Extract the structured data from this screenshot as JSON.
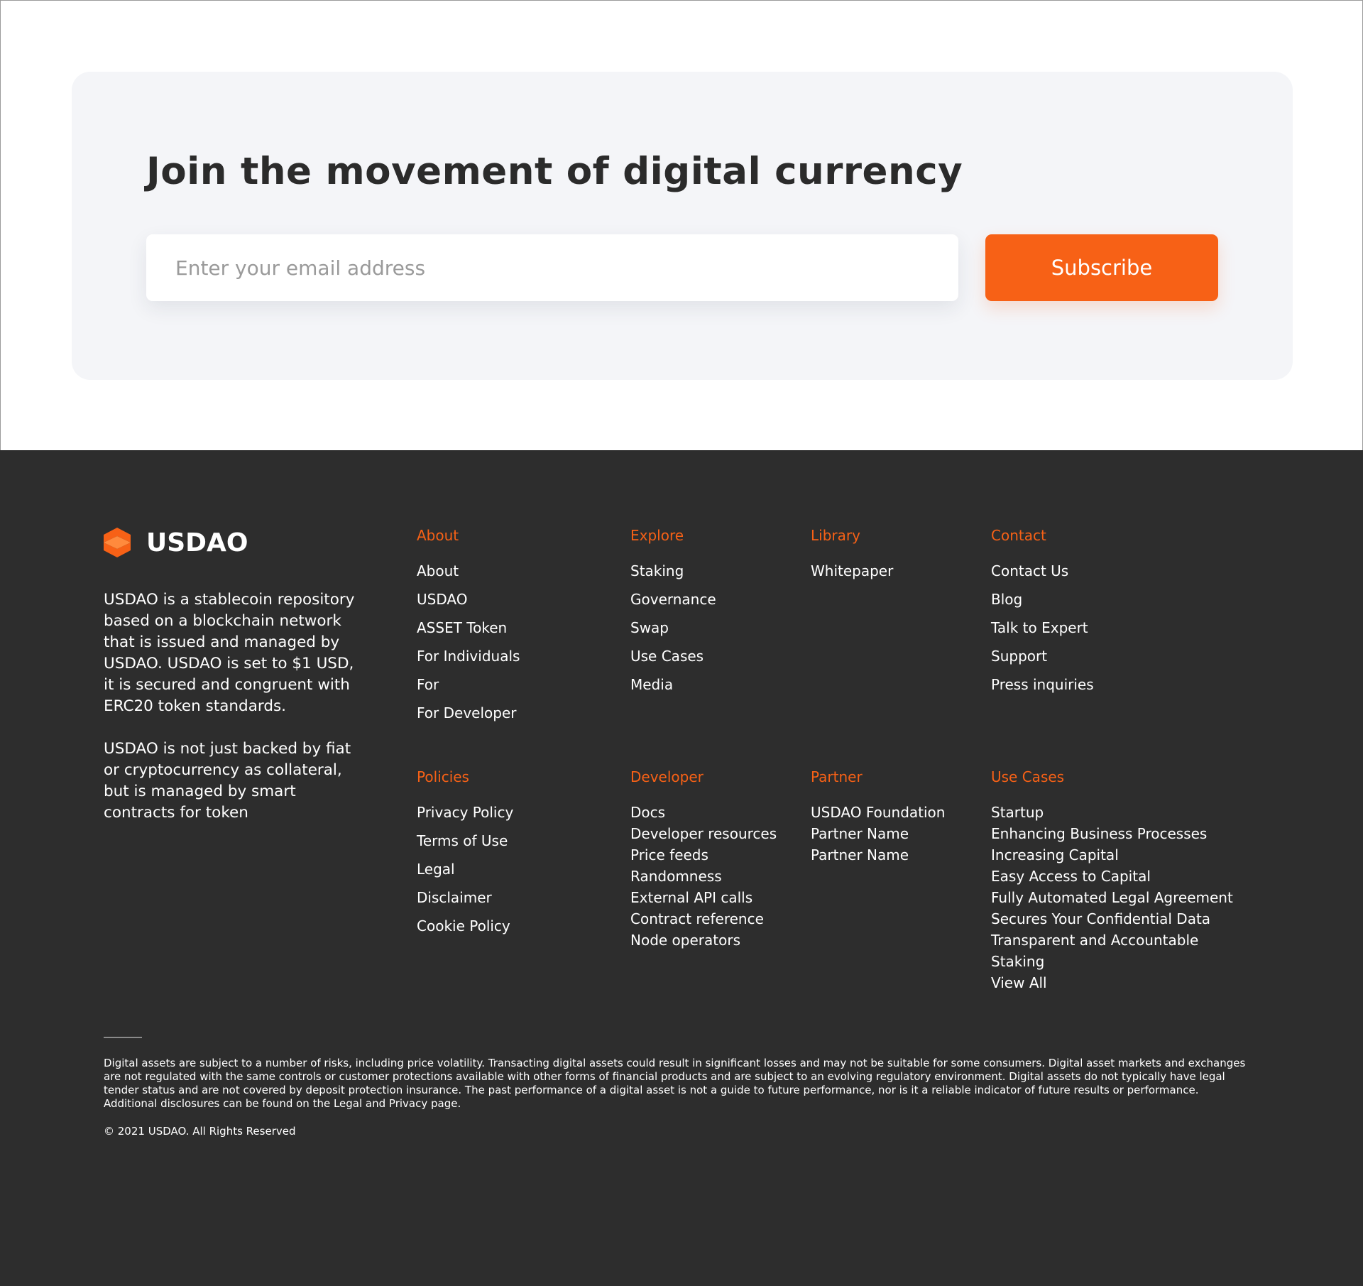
{
  "subscribe": {
    "title": "Join the movement of digital currency",
    "email_placeholder": "Enter your email address",
    "button_label": "Subscribe"
  },
  "brand": {
    "name": "USDAO",
    "logo_icon": "usdao-logo-icon",
    "accent_color": "#f76116",
    "description_1": "USDAO is a stablecoin repository based on a blockchain network that is issued and managed by USDAO. USDAO is set to $1 USD, it is secured and congruent with ERC20 token standards.",
    "description_2": "USDAO is not just backed by fiat or cryptocurrency as collateral, but is managed by smart contracts for token"
  },
  "footer": {
    "background_color": "#2d2d2d",
    "about": {
      "title": "About",
      "links": [
        "About",
        "USDAO",
        "ASSET Token",
        "For Individuals",
        "For",
        "For Developer"
      ]
    },
    "explore": {
      "title": "Explore",
      "links": [
        "Staking",
        "Governance",
        "Swap",
        "Use Cases",
        "Media"
      ]
    },
    "library": {
      "title": "Library",
      "links": [
        "Whitepaper"
      ]
    },
    "contact": {
      "title": "Contact",
      "links": [
        "Contact Us",
        "Blog",
        "Talk to Expert",
        "Support",
        "Press inquiries"
      ]
    },
    "policies": {
      "title": "Policies",
      "links": [
        "Privacy Policy",
        "Terms of Use",
        "Legal",
        "Disclaimer",
        "Cookie Policy"
      ]
    },
    "developer": {
      "title": "Developer",
      "links": [
        "Docs",
        "Developer resources",
        "Price feeds",
        "Randomness",
        "External API calls",
        "Contract reference",
        "Node operators"
      ]
    },
    "partner": {
      "title": "Partner",
      "links": [
        "USDAO Foundation",
        "Partner Name",
        "Partner Name"
      ]
    },
    "use_cases": {
      "title": "Use Cases",
      "links": [
        "Startup",
        "Enhancing Business Processes",
        "Increasing Capital",
        "Easy Access to Capital",
        "Fully Automated Legal Agreement",
        "Secures Your Confidential Data",
        "Transparent and Accountable",
        "Staking",
        "View All"
      ]
    },
    "disclaimer": "Digital assets are subject to a number of risks, including price volatility. Transacting digital assets could result in significant losses and may not be suitable for some consumers. Digital asset markets and exchanges are not regulated with the same controls or customer protections available with other forms of financial products and are subject to an evolving regulatory environment. Digital assets do not typically have legal tender status and are not covered by deposit protection insurance. The past performance of a digital asset is not a guide to future performance, nor is it a reliable indicator of future results or performance. Additional disclosures can be found on the Legal and Privacy page.",
    "copyright": "© 2021 USDAO. All Rights Reserved"
  }
}
